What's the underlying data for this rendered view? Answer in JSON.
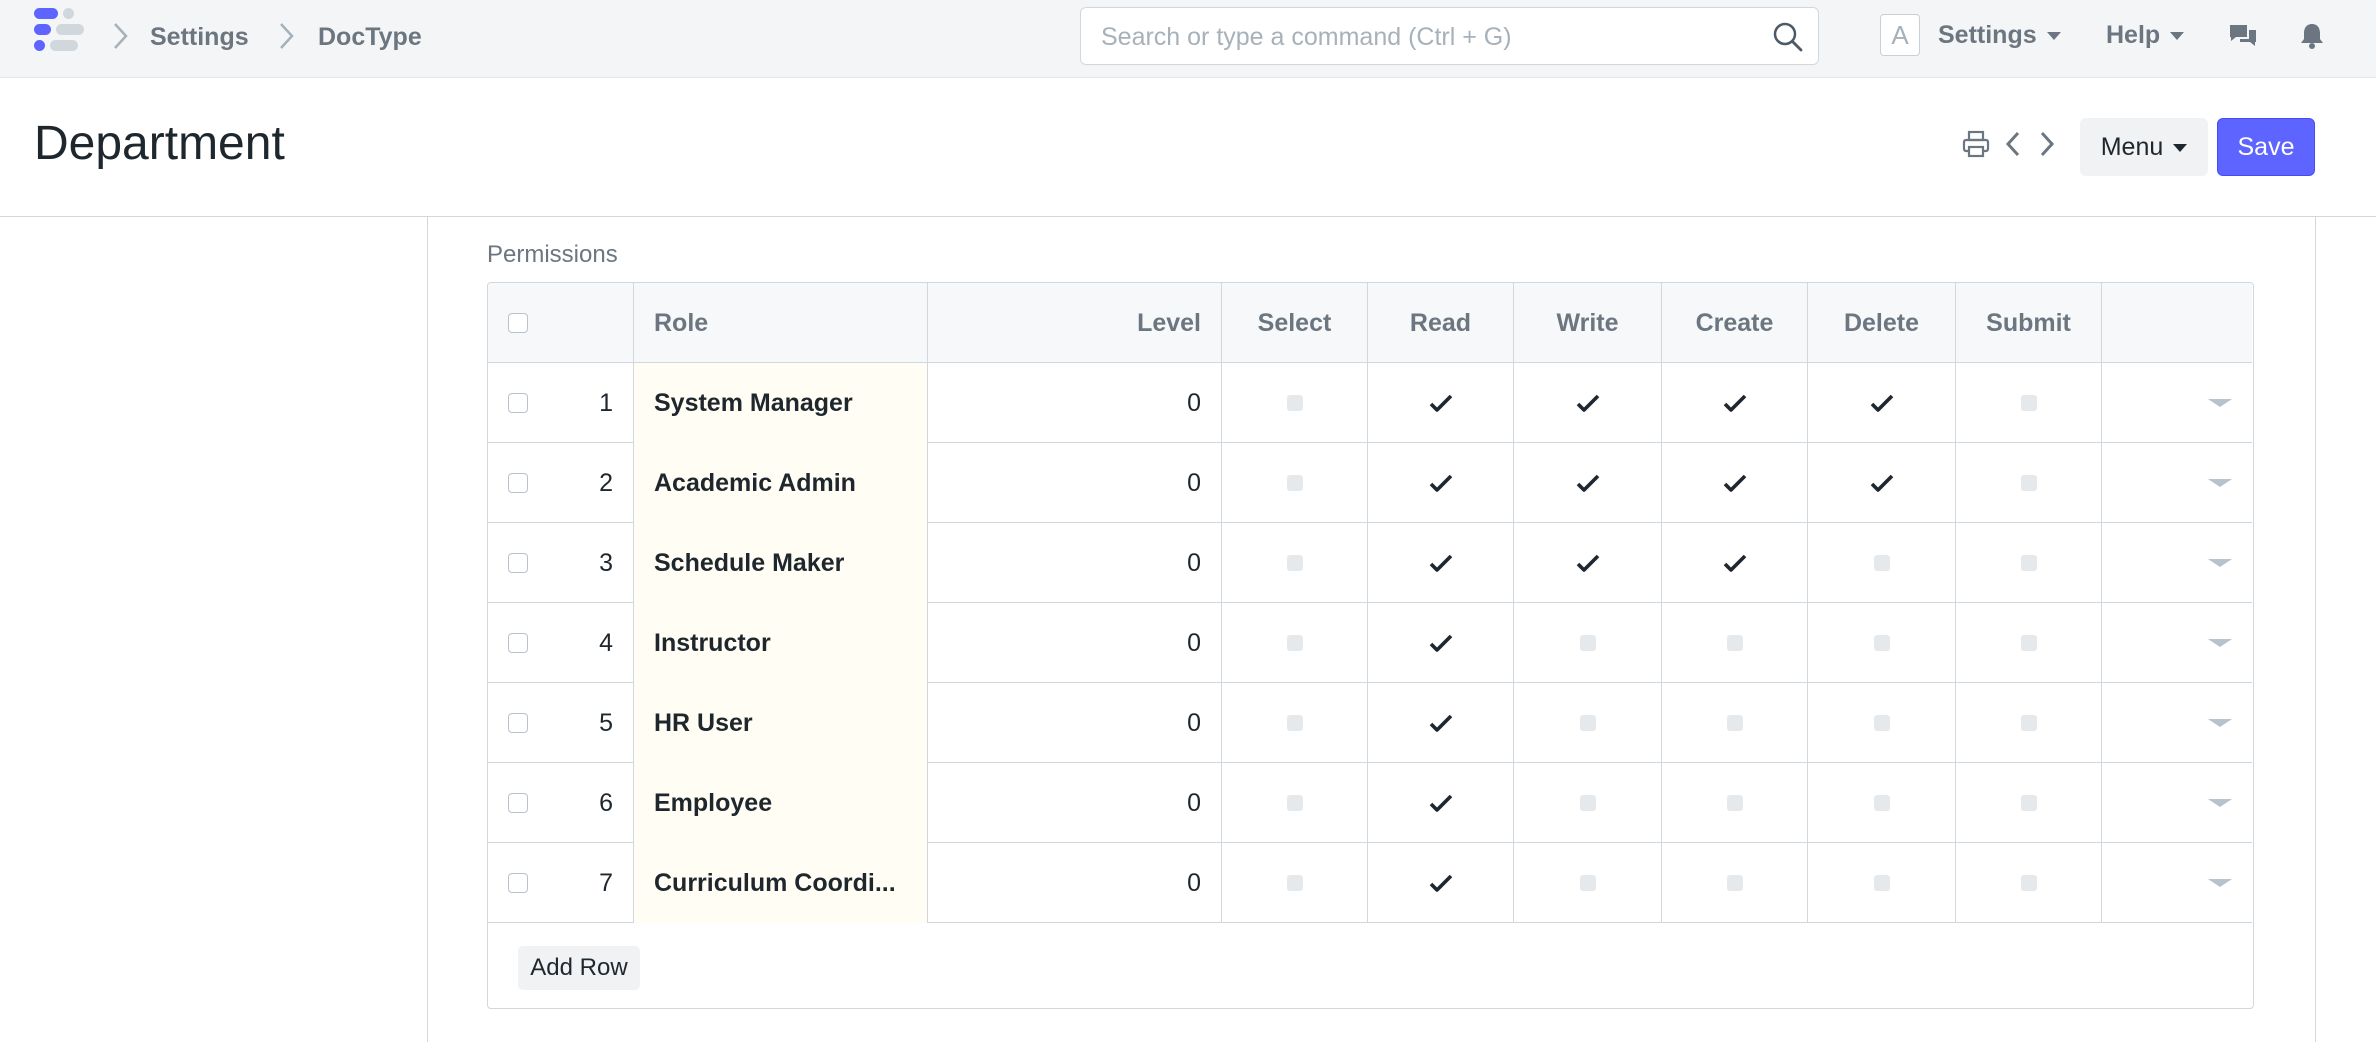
{
  "navbar": {
    "breadcrumbs": [
      "Settings",
      "DocType"
    ],
    "search_placeholder": "Search or type a command (Ctrl + G)",
    "avatar_letter": "A",
    "settings_label": "Settings",
    "help_label": "Help"
  },
  "page": {
    "title": "Department",
    "menu_label": "Menu",
    "save_label": "Save"
  },
  "permissions": {
    "section_label": "Permissions",
    "columns": [
      "Role",
      "Level",
      "Select",
      "Read",
      "Write",
      "Create",
      "Delete",
      "Submit"
    ],
    "rows": [
      {
        "idx": "1",
        "role": "System Manager",
        "level": "0",
        "select": false,
        "read": true,
        "write": true,
        "create": true,
        "delete": true,
        "submit": false
      },
      {
        "idx": "2",
        "role": "Academic Admin",
        "level": "0",
        "select": false,
        "read": true,
        "write": true,
        "create": true,
        "delete": true,
        "submit": false
      },
      {
        "idx": "3",
        "role": "Schedule Maker",
        "level": "0",
        "select": false,
        "read": true,
        "write": true,
        "create": true,
        "delete": false,
        "submit": false
      },
      {
        "idx": "4",
        "role": "Instructor",
        "level": "0",
        "select": false,
        "read": true,
        "write": false,
        "create": false,
        "delete": false,
        "submit": false
      },
      {
        "idx": "5",
        "role": "HR User",
        "level": "0",
        "select": false,
        "read": true,
        "write": false,
        "create": false,
        "delete": false,
        "submit": false
      },
      {
        "idx": "6",
        "role": "Employee",
        "level": "0",
        "select": false,
        "read": true,
        "write": false,
        "create": false,
        "delete": false,
        "submit": false
      },
      {
        "idx": "7",
        "role": "Curriculum Coordi...",
        "level": "0",
        "select": false,
        "read": true,
        "write": false,
        "create": false,
        "delete": false,
        "submit": false
      }
    ],
    "add_row_label": "Add Row"
  },
  "colors": {
    "primary": "#5e64ff",
    "navbar_bg": "#f4f5f6",
    "role_cell_bg": "#fffdf4",
    "border": "#d1d8dd"
  }
}
